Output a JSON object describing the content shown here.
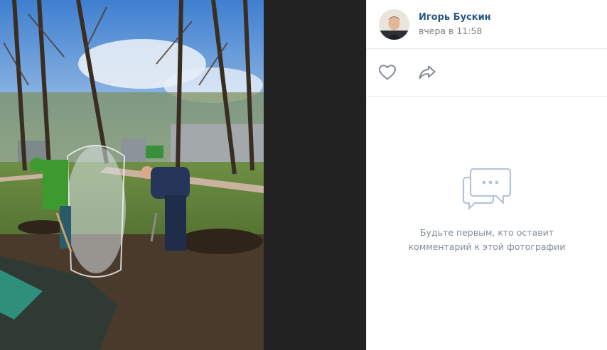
{
  "post": {
    "author_name": "Игорь Бускин",
    "time": "вчера в 11:58"
  },
  "actions": {
    "like_icon": "heart-icon",
    "share_icon": "share-icon"
  },
  "comments": {
    "empty_icon": "comments-bubble-icon",
    "empty_text": "Будьте первым, кто оставит комментарий к этой фотографии"
  },
  "colors": {
    "author": "#2a5885",
    "muted": "#828282",
    "icon": "#818c99",
    "empty_icon": "#b6c4d6",
    "divider": "#e7e8ec",
    "viewer_bg": "#222222"
  }
}
